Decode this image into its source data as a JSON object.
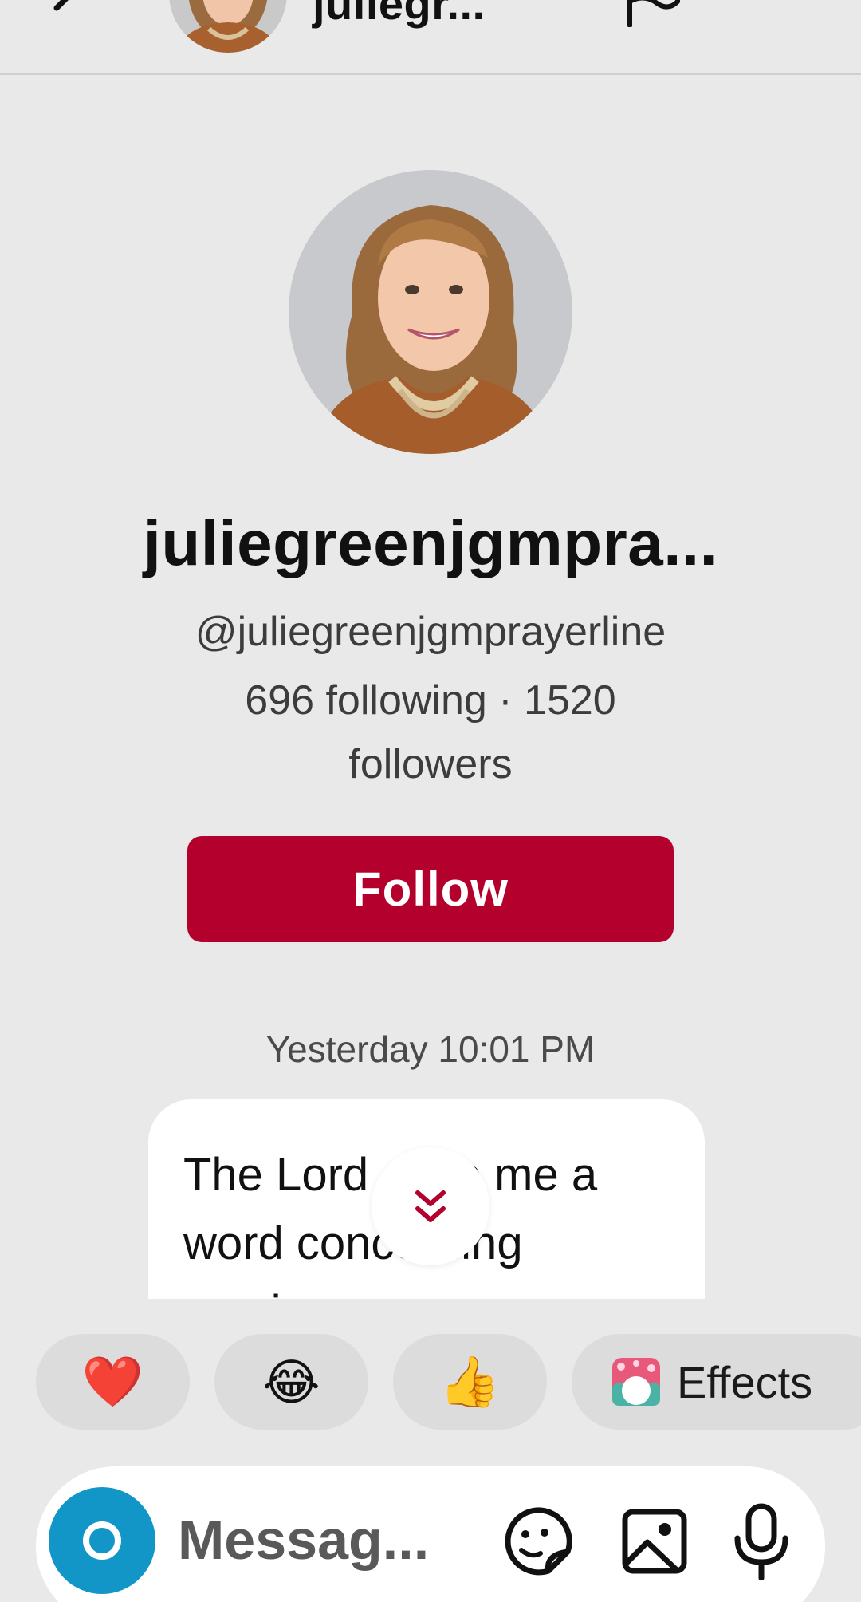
{
  "header": {
    "title": "juliegr...",
    "back_icon": "chevron-left-icon",
    "report_icon": "flag-icon"
  },
  "profile": {
    "display_name": "juliegreenjgmpra...",
    "handle": "@juliegreenjgmprayerline",
    "stats_line1": "696 following · 1520",
    "stats_line2": "followers",
    "follow_label": "Follow"
  },
  "conversation": {
    "timestamp": "Yesterday 10:01 PM",
    "message_line1": "The Lord gave me a",
    "message_line2": "word concerning",
    "message_line3": "you in my prayers"
  },
  "reactions": {
    "heart": "❤️",
    "laugh": "😂",
    "thumbs_up": "👍",
    "effects_icon": "sparkle-gift-icon",
    "effects_label": "Effects"
  },
  "composer": {
    "placeholder": "Messag...",
    "icons": [
      "camera-icon",
      "sticker-icon",
      "image-icon",
      "microphone-icon"
    ]
  },
  "colors": {
    "background": "#e9e9e9",
    "follow_button": "#b3002d",
    "camera_button": "#1296c8",
    "scroll_chevron": "#b3002d"
  }
}
